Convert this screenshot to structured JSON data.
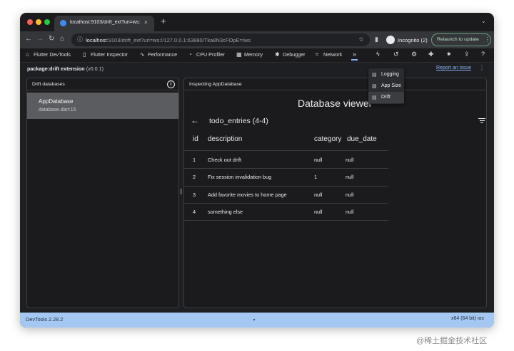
{
  "browser": {
    "tab_title": "localhost:9103/drift_ext?uri=ws://",
    "tab_close": "×",
    "new_tab": "+",
    "url_host": "localhost",
    "url_rest": ":9103/drift_ext?uri=ws://127.0.0.1:63880/Tka8N3cFOpE=/ws",
    "profile_label": "Incognito (2)",
    "relaunch_label": "Relaunch to update"
  },
  "devtools_tabs": [
    {
      "label": "Flutter DevTools",
      "icon": "home-icon"
    },
    {
      "label": "Flutter Inspector",
      "icon": "phone-icon"
    },
    {
      "label": "Performance",
      "icon": "performance-icon"
    },
    {
      "label": "CPU Profiler",
      "icon": "gauge-icon"
    },
    {
      "label": "Memory",
      "icon": "memory-icon"
    },
    {
      "label": "Debugger",
      "icon": "bug-icon"
    },
    {
      "label": "Network",
      "icon": "wifi-icon"
    }
  ],
  "more_tabs_label": "»",
  "overflow_menu": [
    {
      "label": "Logging",
      "icon": "logging-icon"
    },
    {
      "label": "App Size",
      "icon": "app-size-icon"
    },
    {
      "label": "Drift",
      "icon": "drift-icon",
      "active": true
    }
  ],
  "extension": {
    "package": "package:drift extension",
    "version": "(v0.0.1)",
    "report_link": "Report an issue"
  },
  "left_panel": {
    "title": "Drift databases",
    "info_icon": "i",
    "databases": [
      {
        "name": "AppDatabase",
        "file": "database.dart:15"
      }
    ]
  },
  "right_panel": {
    "title": "Inspecting AppDatabase",
    "viewer_title": "Database viewer",
    "table_name": "todo_entries (4-4)",
    "columns": [
      "id",
      "description",
      "category",
      "due_date"
    ],
    "rows": [
      [
        "1",
        "Check out drift",
        "null",
        "null"
      ],
      [
        "2",
        "Fix session invalidation bug",
        "1",
        "null"
      ],
      [
        "3",
        "Add favorite movies to home page",
        "null",
        "null"
      ],
      [
        "4",
        "something else",
        "null",
        "null"
      ]
    ]
  },
  "status": {
    "left": "DevTools 2.28.2",
    "right": "x64 (64 bit) ios"
  },
  "watermark": "@稀土掘金技术社区",
  "colors": {
    "status_bar": "#a5c8f2",
    "selected_db": "#5b5c5f",
    "link": "#8ab4f8",
    "relaunch_border": "#5f9f7a"
  }
}
